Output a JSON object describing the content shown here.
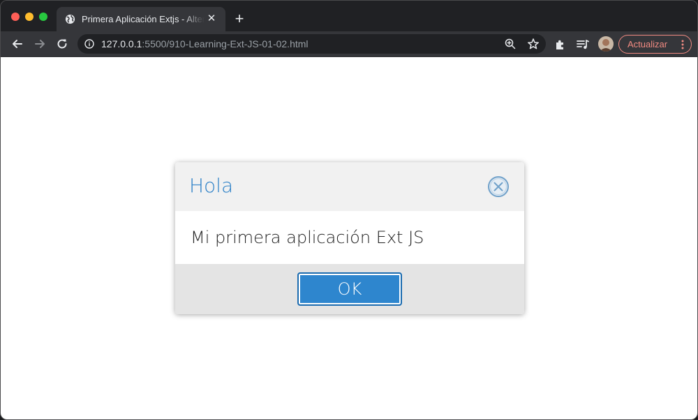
{
  "browser": {
    "tab": {
      "title": "Primera Aplicación Extjs - Alternative",
      "favicon": "globe-icon",
      "close": "✕"
    },
    "new_tab": "+",
    "url": {
      "host": "127.0.0.1",
      "path": ":5500/910-Learning-Ext-JS-01-02.html"
    },
    "update_label": "Actualizar",
    "colors": {
      "frame": "#202124",
      "toolbar": "#35363a",
      "update_accent": "#f28b82"
    }
  },
  "dialog": {
    "title": "Hola",
    "message": "Mi primera aplicación Ext JS",
    "ok_label": "OK",
    "colors": {
      "title": "#2f82c8",
      "button": "#2e86ce"
    }
  }
}
